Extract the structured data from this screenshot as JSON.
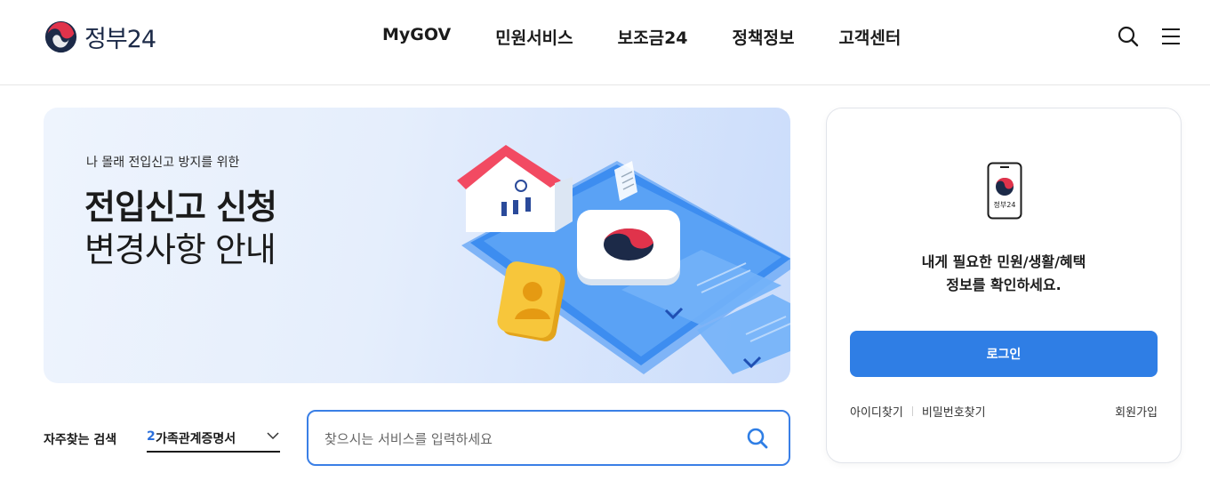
{
  "header": {
    "logo_text": "정부24",
    "nav": [
      "MyGOV",
      "민원서비스",
      "보조금24",
      "정책정보",
      "고객센터"
    ],
    "icons": [
      "search-icon",
      "menu-icon"
    ]
  },
  "banner": {
    "eyebrow": "나 몰래 전입신고 방지를 위한",
    "title": "전입신고 신청",
    "subtitle": "변경사항 안내"
  },
  "quick_search": {
    "label": "자주찾는 검색",
    "selected_number": "2",
    "selected_text": "가족관계증명서",
    "search_placeholder": "찾으시는 서비스를 입력하세요"
  },
  "login": {
    "device_label": "정부24",
    "message_line1": "내게 필요한 민원/생활/혜택",
    "message_line2": "정보를 확인하세요.",
    "login_button": "로그인",
    "find_id": "아이디찾기",
    "find_password": "비밀번호찾기",
    "signup": "회원가입"
  },
  "colors": {
    "accent": "#2f7ee5",
    "search_border": "#3a7fe6",
    "brand_navy": "#1c2a48",
    "brand_red": "#e0334b"
  }
}
